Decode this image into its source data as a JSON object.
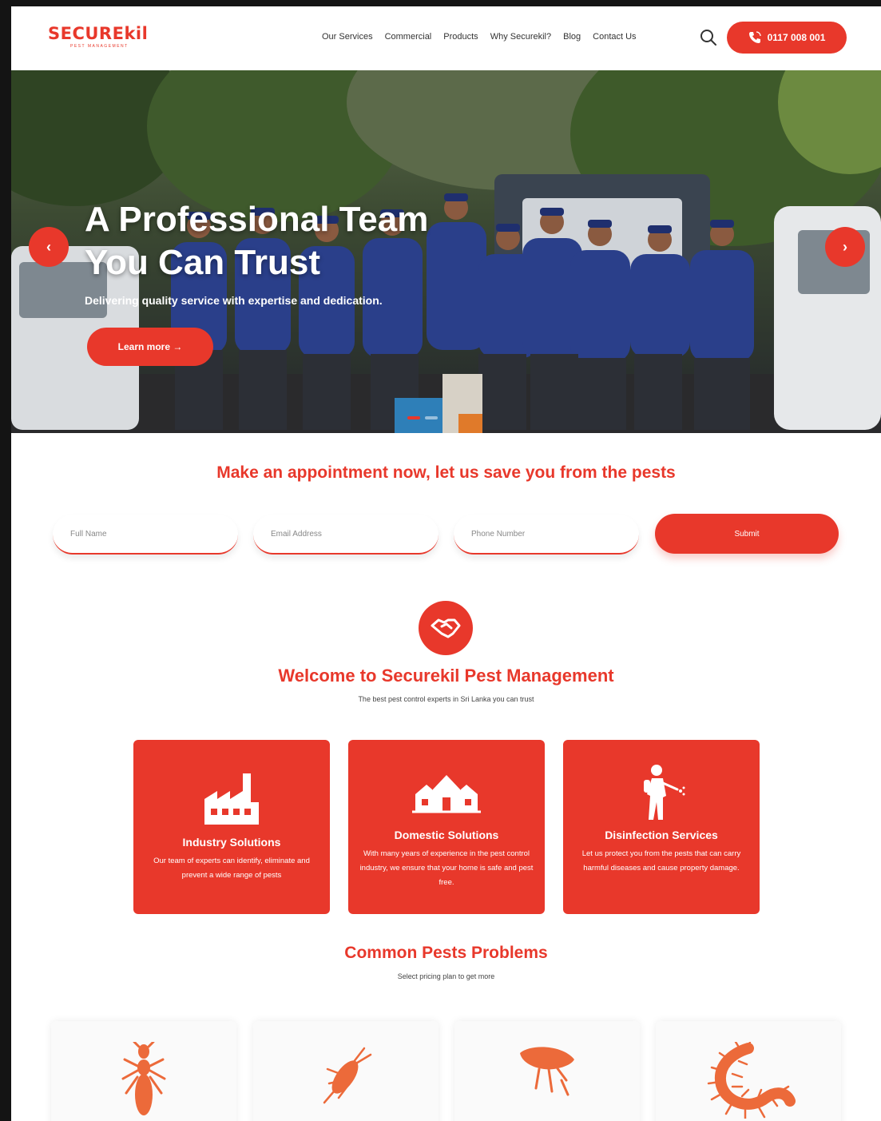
{
  "header": {
    "logo_main": "SECUREkil",
    "logo_sub": "PEST MANAGEMENT",
    "nav": [
      "Our Services",
      "Commercial",
      "Products",
      "Why Securekil?",
      "Blog",
      "Contact Us"
    ],
    "phone": "0117 008 001"
  },
  "hero": {
    "title_line1": "A Professional Team",
    "title_line2": "You Can Trust",
    "subtitle": "Delivering quality service with expertise and dedication.",
    "cta": "Learn more →",
    "prev_arrow": "‹",
    "next_arrow": "›",
    "active_slide": 1,
    "slide_count": 2
  },
  "appointment": {
    "title": "Make an appointment now, let us save you from the pests",
    "full_name_placeholder": "Full Name",
    "email_placeholder": "Email Address",
    "phone_placeholder": "Phone Number",
    "submit": "Submit"
  },
  "welcome": {
    "title": "Welcome to Securekil Pest Management",
    "subtitle": "The best pest control experts in Sri Lanka you can trust"
  },
  "services": [
    {
      "title": "Industry Solutions",
      "desc": "Our team of experts can identify, eliminate and prevent a wide range of pests"
    },
    {
      "title": "Domestic Solutions",
      "desc": "With many years of experience in the pest control industry, we ensure that your home is safe and pest free."
    },
    {
      "title": "Disinfection Services",
      "desc": "Let us protect you from the pests that can carry harmful diseases and cause property damage."
    }
  ],
  "pests": {
    "title": "Common Pests Problems",
    "subtitle": "Select pricing plan to get more"
  },
  "colors": {
    "accent": "#e8382b",
    "pest_icon": "#ec6a3a"
  }
}
